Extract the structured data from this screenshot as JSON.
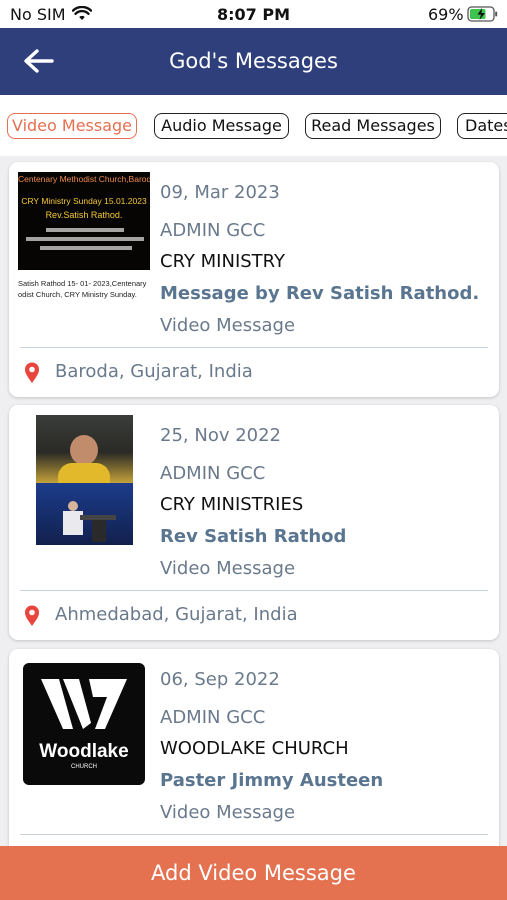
{
  "status_bar": {
    "carrier": "No SIM",
    "time": "8:07 PM",
    "battery_percent": "69%",
    "icons": [
      "wifi-icon",
      "battery-charging-icon"
    ]
  },
  "header": {
    "title": "God's Messages",
    "back_icon": "arrow-left-icon"
  },
  "tabs": [
    {
      "label": "Video Message",
      "active": true
    },
    {
      "label": "Audio Message",
      "active": false
    },
    {
      "label": "Read Messages",
      "active": false
    },
    {
      "label": "Dates",
      "active": false
    }
  ],
  "messages": [
    {
      "date": "09, Mar 2023",
      "author": "ADMIN GCC",
      "church": "CRY MINISTRY",
      "speaker": "Message by Rev Satish Rathod.",
      "type": "Video Message",
      "location": "Baroda, Gujarat, India",
      "thumbnail": {
        "title_line": "Centenary Methodist Church,Baroda",
        "subtitle_line": "CRY Ministry Sunday  15.01.2023",
        "speaker_line": "Rev.Satish Rathod.",
        "caption_line1": "Satish Rathod 15- 01- 2023,Centenary",
        "caption_line2": "odist Church, CRY Ministry Sunday."
      }
    },
    {
      "date": "25, Nov 2022",
      "author": "ADMIN GCC",
      "church": "CRY MINISTRIES",
      "speaker": "Rev Satish Rathod",
      "type": "Video Message",
      "location": "Ahmedabad, Gujarat, India"
    },
    {
      "date": "06, Sep 2022",
      "author": "ADMIN GCC",
      "church": "WOODLAKE CHURCH",
      "speaker": "Paster Jimmy Austeen",
      "type": "Video Message",
      "location": "",
      "thumbnail": {
        "logo_text": "Woodlake",
        "logo_subtext": "CHURCH"
      }
    }
  ],
  "add_button_label": "Add Video Message",
  "colors": {
    "header_bg": "#2e3f7c",
    "accent": "#e4714f",
    "pin": "#e8453c"
  }
}
